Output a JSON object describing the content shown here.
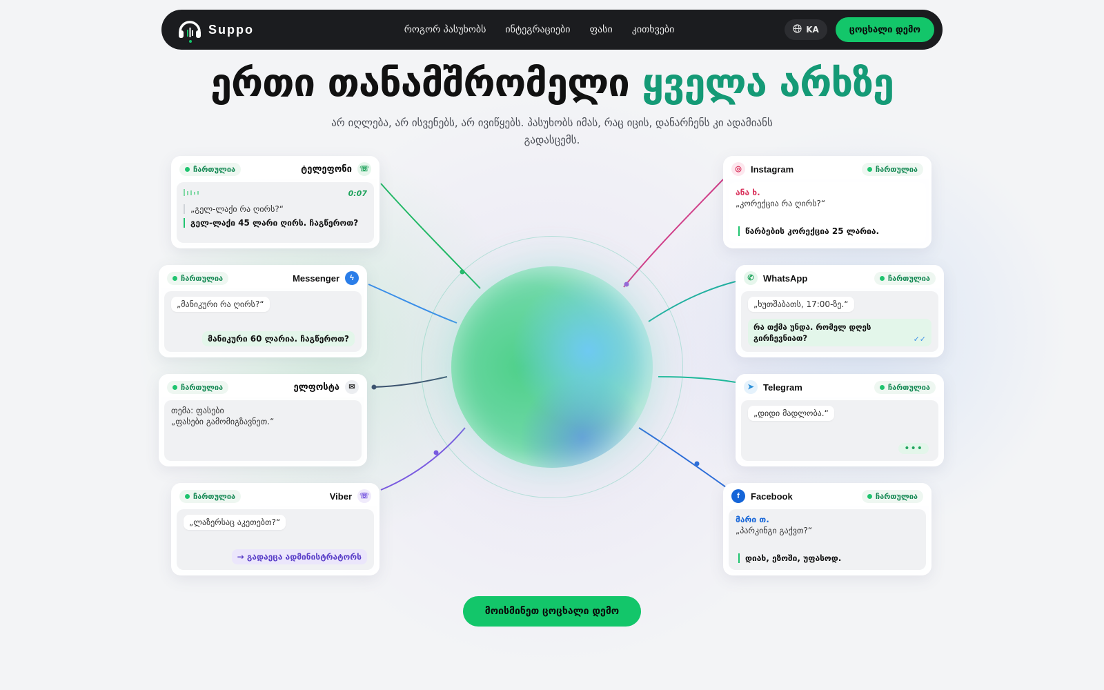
{
  "nav": {
    "brand": "Suppo",
    "links": [
      "როგორ პასუხობს",
      "ინტეგრაციები",
      "ფასი",
      "კითხვები"
    ],
    "lang": "KA",
    "demo_button": "ცოცხალი დემო"
  },
  "hero": {
    "title_main": "ერთი თანამშრომელი",
    "title_accent": "ყველა არხზე",
    "subtitle": "არ იღლება, არ ისვენებს, არ ივიწყებს. პასუხობს იმას, რაც იცის, დანარჩენს კი ადამიანს გადასცემს."
  },
  "cards": {
    "phone": {
      "status": "ჩართულია",
      "channel": "ტელეფონი",
      "timer": "0:07",
      "question": "„გელ-ლაქი რა ღირს?“",
      "answer": "გელ-ლაქი 45 ლარი ღირს. ჩაგწეროთ?"
    },
    "messenger": {
      "status": "ჩართულია",
      "channel": "Messenger",
      "question": "„მანიკური რა ღირს?“",
      "answer": "მანიკური 60 ლარია. ჩაგწეროთ?"
    },
    "email": {
      "status": "ჩართულია",
      "channel": "ელფოსტა",
      "subject": "თემა: ფასები",
      "question": "„ფასები გამომიგზავნეთ.“"
    },
    "viber": {
      "status": "ჩართულია",
      "channel": "Viber",
      "question": "„ლაზერსაც აკეთებთ?“",
      "handoff": "გადაეცა ადმინისტრატორს"
    },
    "instagram": {
      "status": "ჩართულია",
      "channel": "Instagram",
      "name": "ანა ხ.",
      "question": "„კორექცია რა ღირს?“",
      "answer": "წარბების კორექცია 25 ლარია."
    },
    "whatsapp": {
      "status": "ჩართულია",
      "channel": "WhatsApp",
      "question": "„ხუთშაბათს, 17:00-ზე.“",
      "answer": "რა თქმა უნდა. რომელ დღეს გირჩევნიათ?"
    },
    "telegram": {
      "status": "ჩართულია",
      "channel": "Telegram",
      "question": "„დიდი მადლობა.“"
    },
    "facebook": {
      "status": "ჩართულია",
      "channel": "Facebook",
      "name": "მარი თ.",
      "question": "„პარკინგი გაქვთ?“",
      "answer": "დიახ, ეზოში, უფასოდ."
    }
  },
  "cta": "მოისმინეთ ცოცხალი დემო",
  "colors": {
    "accent_green": "#13c66a",
    "title_accent": "#149a76",
    "nav_bg": "#1b1c1f"
  }
}
